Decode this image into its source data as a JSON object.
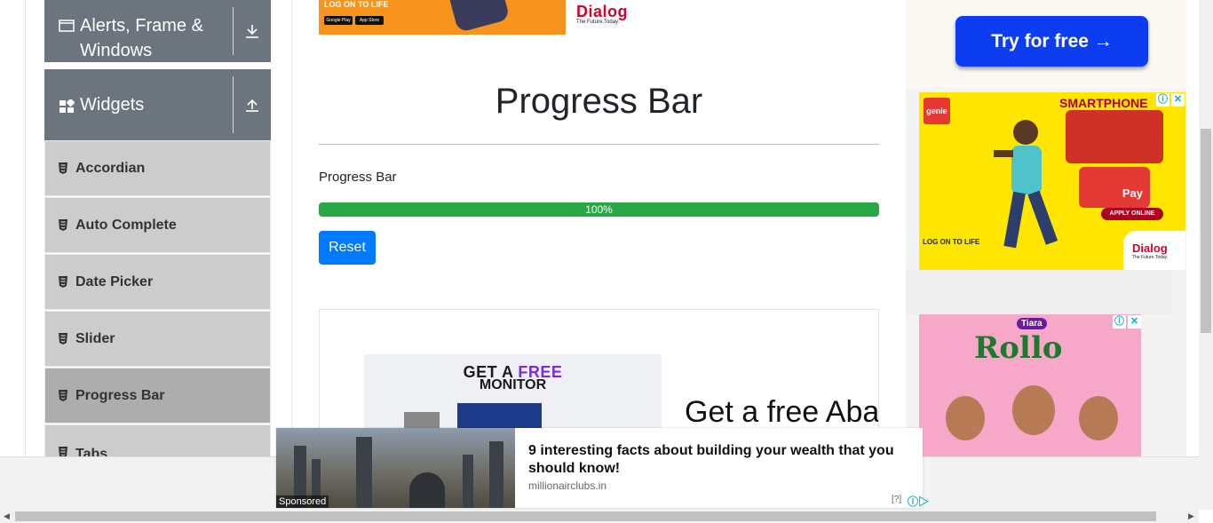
{
  "sidebar": {
    "groups": [
      {
        "label": "Alerts, Frame & Windows",
        "icon": "window-icon",
        "toggle_icon": "arrow-down-icon"
      },
      {
        "label": "Widgets",
        "icon": "widgets-icon",
        "toggle_icon": "arrow-up-icon"
      }
    ],
    "items": [
      {
        "label": "Accordian",
        "icon": "html5-icon"
      },
      {
        "label": "Auto Complete",
        "icon": "html5-icon"
      },
      {
        "label": "Date Picker",
        "icon": "html5-icon"
      },
      {
        "label": "Slider",
        "icon": "html5-icon"
      },
      {
        "label": "Progress Bar",
        "icon": "html5-icon",
        "active": true
      },
      {
        "label": "Tabs",
        "icon": "html5-icon"
      }
    ]
  },
  "top_ad": {
    "text": "LOG ON TO LIFE",
    "brand": "Dialog",
    "tagline": "The Future.Today.",
    "badges": [
      "Google Play",
      "App Store"
    ]
  },
  "main": {
    "title": "Progress Bar",
    "progress_label": "Progress Bar",
    "progress_value": 100,
    "progress_text": "100%",
    "reset_label": "Reset"
  },
  "content_ad": {
    "image_line1_a": "GET A ",
    "image_line1_b": "FREE",
    "image_line2": "MONITOR",
    "headline": "Get a free Aban"
  },
  "right_ads": {
    "try_button": "Try for free →",
    "genie": {
      "logo": "genie",
      "headline": "SMARTPHONE",
      "pay_text": "Pay",
      "apply": "APPLY ONLINE",
      "log_on": "LOG ON TO LIFE",
      "brand": "Dialog",
      "tagline": "The Future.Today."
    },
    "rollo": {
      "brand": "Rollo",
      "sub_brand": "Tiara"
    },
    "ad_info": "ⓘ",
    "ad_close": "✕"
  },
  "sponsored": {
    "label": "Sponsored",
    "title": "9 interesting facts about building your wealth that you should know!",
    "domain": "millionairclubs.in",
    "help": "[?]",
    "adchoices": "ⓘ▷"
  },
  "colors": {
    "sidebar_header": "#6c757d",
    "menu_item": "#cccccc",
    "menu_item_active": "#adadad",
    "progress_fill": "#28a745",
    "reset_button": "#007bff",
    "try_button": "#0d3df0"
  }
}
